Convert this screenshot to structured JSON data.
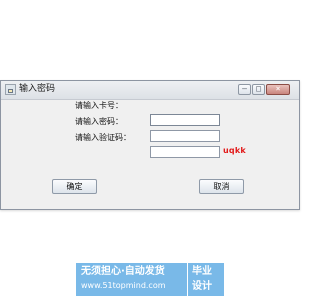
{
  "window": {
    "title": "输入密码",
    "icon": "dialog-window-icon",
    "controls": {
      "minimize_glyph": "—",
      "maximize_glyph": "□",
      "close_glyph": "×"
    }
  },
  "form": {
    "card_label": "请输入卡号：",
    "password_label": "请输入密码：",
    "captcha_label": "请输入验证码：",
    "card_value": "",
    "password_value": "",
    "captcha_value": "",
    "captcha_text": "uqkk"
  },
  "buttons": {
    "ok_label": "确定",
    "cancel_label": "取消"
  },
  "watermark": {
    "line1": "无须担心·自动发货",
    "line2": "www.51topmind.com",
    "badge_line1": "毕业",
    "badge_line2": "设计"
  },
  "colors": {
    "captcha": "#e21b1b",
    "watermark": "#79b9e8"
  }
}
